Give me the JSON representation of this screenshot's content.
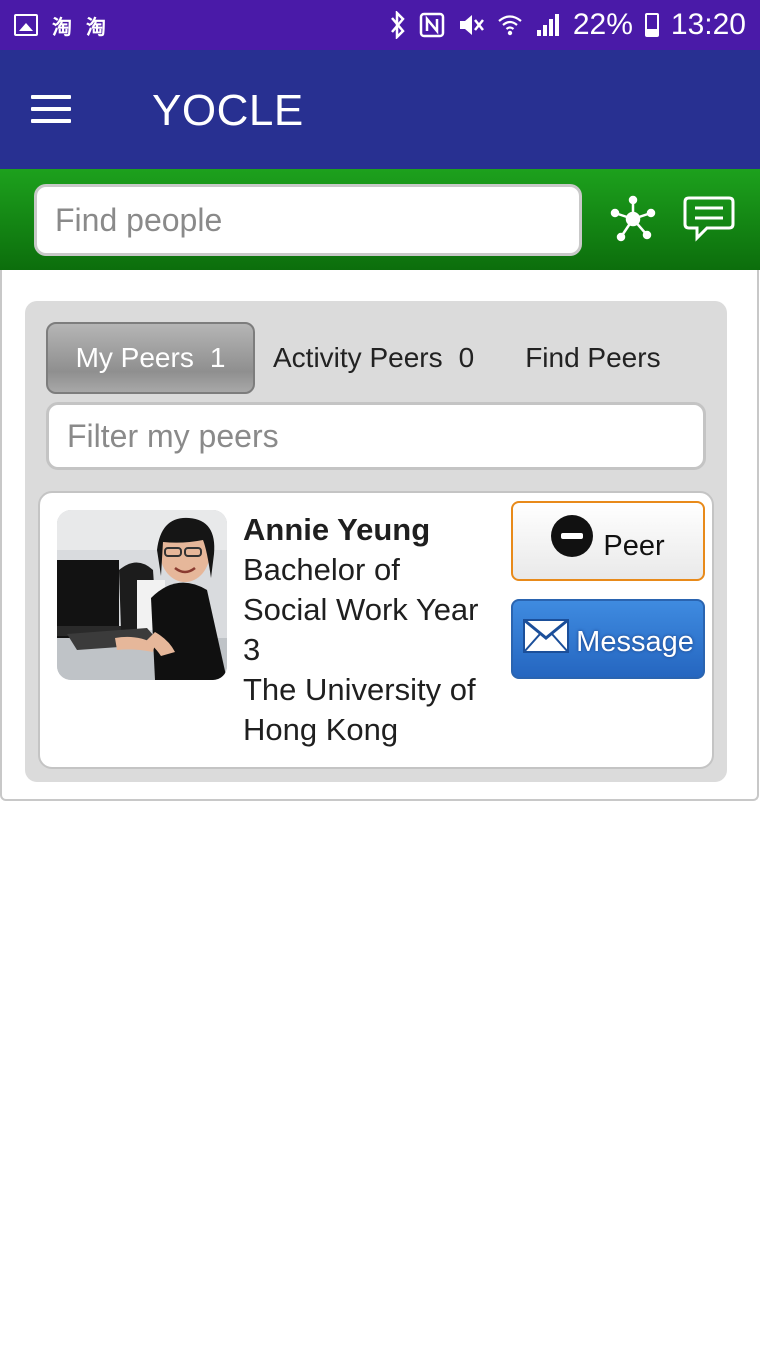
{
  "status_bar": {
    "left_icons": [
      "gallery-icon",
      "taobao-icon",
      "taobao-icon"
    ],
    "taobao_glyph": "淘",
    "battery_percent": "22%",
    "time": "13:20",
    "right_icons": [
      "bluetooth-icon",
      "nfc-icon",
      "mute-icon",
      "wifi-icon",
      "signal-icon",
      "battery-charging-icon"
    ]
  },
  "app_bar": {
    "title": "YOCLE",
    "menu_icon": "hamburger-menu-icon"
  },
  "search": {
    "placeholder": "Find people",
    "icons": [
      "network-icon",
      "chat-icon"
    ]
  },
  "tabs": [
    {
      "label": "My Peers",
      "count": "1",
      "active": true
    },
    {
      "label": "Activity Peers",
      "count": "0",
      "active": false
    },
    {
      "label": "Find Peers",
      "count": "",
      "active": false
    }
  ],
  "filter": {
    "placeholder": "Filter my peers"
  },
  "peer_card": {
    "name": "Annie Yeung",
    "programme": [
      "Bachelor of",
      "Social Work Year",
      "3"
    ],
    "institution": [
      "The University of",
      "Hong Kong"
    ],
    "peer_button_label": "Peer",
    "message_button_label": "Message"
  },
  "colors": {
    "status_bar": "#4a1aa8",
    "app_bar": "#283091",
    "search_band": "#1da11d",
    "peer_button_border": "#e88a1a",
    "message_button": "#2566c0"
  }
}
